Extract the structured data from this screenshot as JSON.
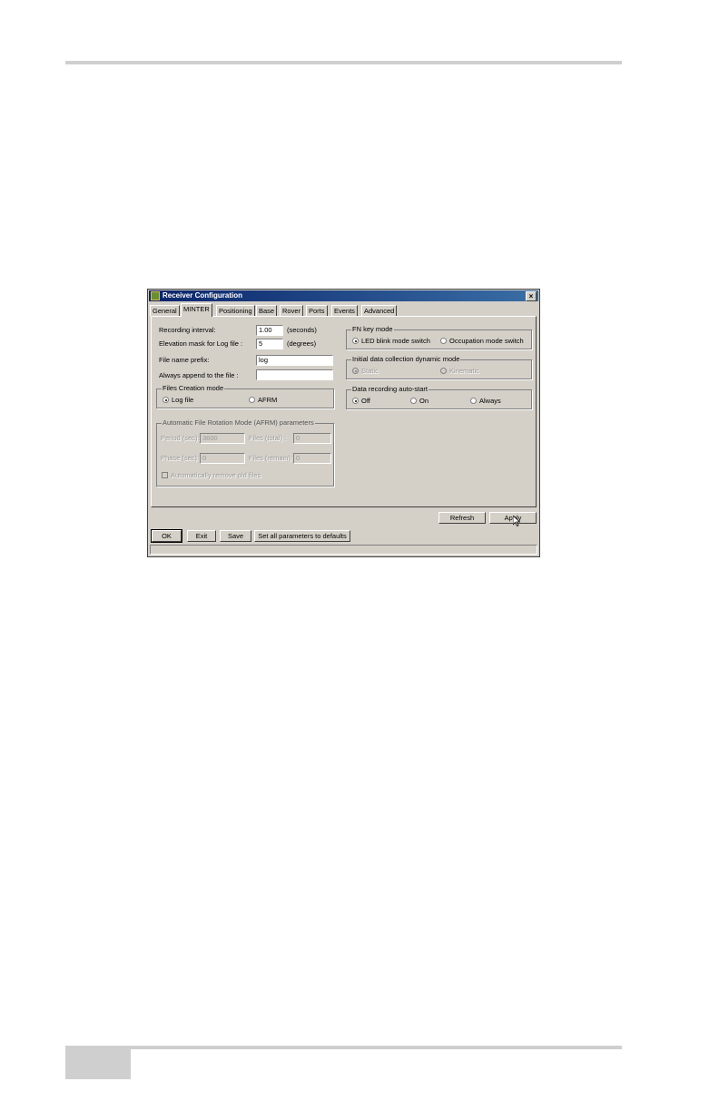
{
  "window": {
    "title": "Receiver Configuration",
    "close_glyph": "×"
  },
  "tabs": [
    "General",
    "MINTER",
    "Positioning",
    "Base",
    "Rover",
    "Ports",
    "Events",
    "Advanced"
  ],
  "active_tab": "MINTER",
  "left": {
    "recording_interval": {
      "label": "Recording interval:",
      "value": "1.00",
      "unit": "(seconds)"
    },
    "elevation_mask": {
      "label": "Elevation mask for Log file :",
      "value": "5",
      "unit": "(degrees)"
    },
    "file_prefix": {
      "label": "File name prefix:",
      "value": "log"
    },
    "always_append": {
      "label": "Always append to the file :",
      "value": ""
    },
    "files_creation_mode": {
      "title": "Files Creation mode",
      "options": [
        "Log file",
        "AFRM"
      ],
      "selected": "Log file"
    },
    "afrm": {
      "title": "Automatic File Rotation Mode (AFRM) parameters",
      "period_label": "Period (sec):",
      "period_value": "3600",
      "files_total_label": "Files (total) :",
      "files_total_value": "0",
      "phase_label": "Phase (sec):",
      "phase_value": "0",
      "files_remain_label": "Files (remain):",
      "files_remain_value": "0",
      "auto_remove_label": "Automatically remove old files"
    }
  },
  "right": {
    "fn_key_mode": {
      "title": "FN key mode",
      "options": [
        "LED blink mode switch",
        "Occupation mode switch"
      ],
      "selected": "LED blink mode switch"
    },
    "initial_dynamic": {
      "title": "Initial data collection dynamic mode",
      "options": [
        "Static",
        "Kinematic"
      ],
      "selected": "Static"
    },
    "auto_start": {
      "title": "Data recording auto-start",
      "options": [
        "Off",
        "On",
        "Always"
      ],
      "selected": "Off"
    }
  },
  "buttons": {
    "refresh": "Refresh",
    "apply": "Apply",
    "ok": "OK",
    "exit": "Exit",
    "save": "Save",
    "defaults": "Set all parameters to defaults"
  },
  "icons": {
    "app": "receiver-app-icon",
    "cursor": "mouse-pointer-icon"
  }
}
